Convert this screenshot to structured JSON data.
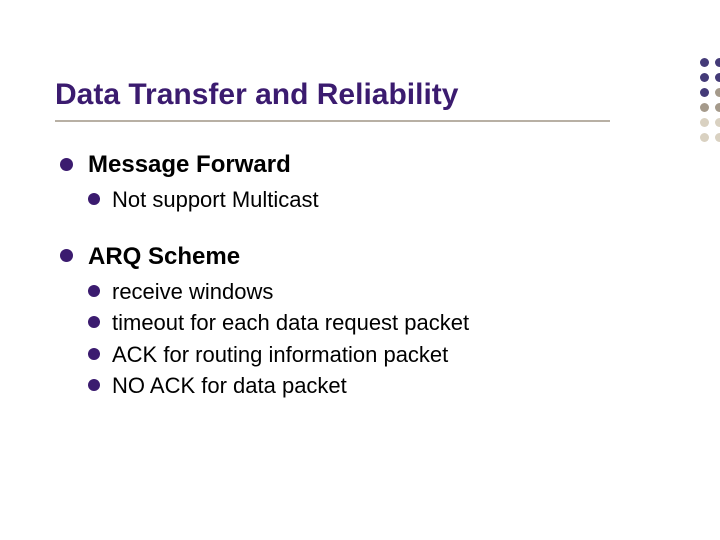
{
  "title": "Data Transfer and Reliability",
  "sections": [
    {
      "heading": "Message Forward",
      "items": [
        "Not support Multicast"
      ]
    },
    {
      "heading": "ARQ Scheme",
      "items": [
        "receive windows",
        "timeout for each data request packet",
        "ACK for routing information packet",
        "NO ACK for data packet"
      ]
    }
  ],
  "dot_colors": {
    "dark": "#443b78",
    "mid": "#a59a8b",
    "light": "#d9d1c1",
    "accent": "#b7a84a"
  }
}
